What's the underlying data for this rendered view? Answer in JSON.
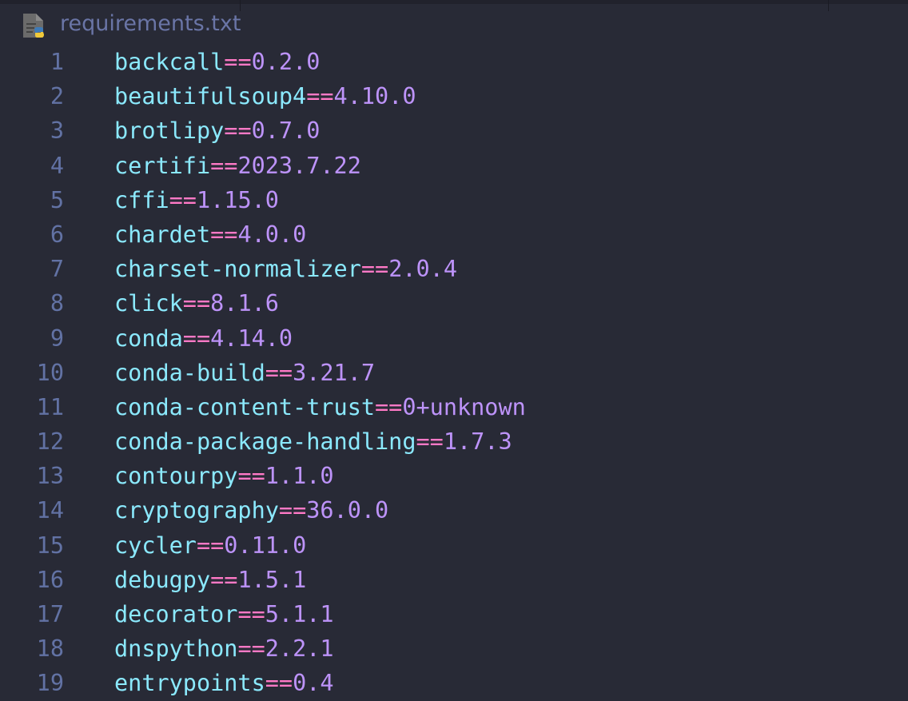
{
  "tab": {
    "title": "requirements.txt",
    "icon": "python-file-icon"
  },
  "colors": {
    "background": "#282a36",
    "package": "#8be9fd",
    "operator": "#ff79c6",
    "version": "#bd93f9",
    "line_number": "#6272a4"
  },
  "lines": [
    {
      "num": "1",
      "pkg": "backcall",
      "op": "==",
      "ver": "0.2.0"
    },
    {
      "num": "2",
      "pkg": "beautifulsoup4",
      "op": "==",
      "ver": "4.10.0"
    },
    {
      "num": "3",
      "pkg": "brotlipy",
      "op": "==",
      "ver": "0.7.0"
    },
    {
      "num": "4",
      "pkg": "certifi",
      "op": "==",
      "ver": "2023.7.22"
    },
    {
      "num": "5",
      "pkg": "cffi",
      "op": "==",
      "ver": "1.15.0"
    },
    {
      "num": "6",
      "pkg": "chardet",
      "op": "==",
      "ver": "4.0.0"
    },
    {
      "num": "7",
      "pkg": "charset-normalizer",
      "op": "==",
      "ver": "2.0.4"
    },
    {
      "num": "8",
      "pkg": "click",
      "op": "==",
      "ver": "8.1.6"
    },
    {
      "num": "9",
      "pkg": "conda",
      "op": "==",
      "ver": "4.14.0"
    },
    {
      "num": "10",
      "pkg": "conda-build",
      "op": "==",
      "ver": "3.21.7"
    },
    {
      "num": "11",
      "pkg": "conda-content-trust",
      "op": "==",
      "ver": "0+unknown"
    },
    {
      "num": "12",
      "pkg": "conda-package-handling",
      "op": "==",
      "ver": "1.7.3"
    },
    {
      "num": "13",
      "pkg": "contourpy",
      "op": "==",
      "ver": "1.1.0"
    },
    {
      "num": "14",
      "pkg": "cryptography",
      "op": "==",
      "ver": "36.0.0"
    },
    {
      "num": "15",
      "pkg": "cycler",
      "op": "==",
      "ver": "0.11.0"
    },
    {
      "num": "16",
      "pkg": "debugpy",
      "op": "==",
      "ver": "1.5.1"
    },
    {
      "num": "17",
      "pkg": "decorator",
      "op": "==",
      "ver": "5.1.1"
    },
    {
      "num": "18",
      "pkg": "dnspython",
      "op": "==",
      "ver": "2.2.1"
    },
    {
      "num": "19",
      "pkg": "entrypoints",
      "op": "==",
      "ver": "0.4"
    }
  ]
}
